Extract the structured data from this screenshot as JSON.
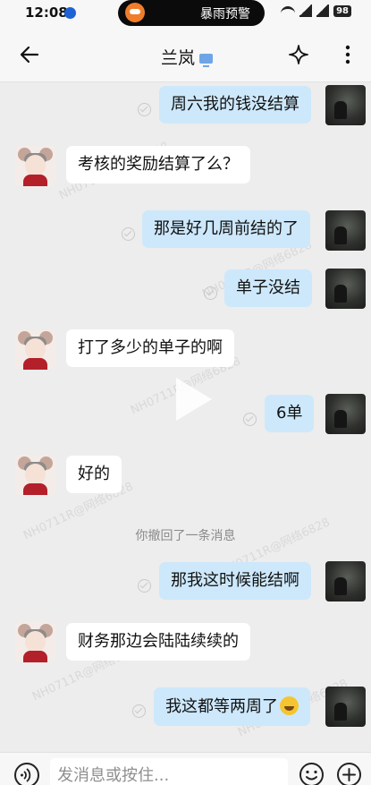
{
  "status_bar": {
    "time": "12:08",
    "alert": "暴雨预警",
    "battery": "98"
  },
  "header": {
    "title": "兰岚",
    "icons": [
      "back-arrow-icon",
      "device-icon",
      "sparkle-icon",
      "more-vertical-icon"
    ]
  },
  "messages": [
    {
      "from": "me",
      "text": "周六我的钱没结算"
    },
    {
      "from": "them",
      "text": "考核的奖励结算了么？"
    },
    {
      "from": "me",
      "text": "那是好几周前结的了"
    },
    {
      "from": "me",
      "text": "单子没结"
    },
    {
      "from": "them",
      "text": "打了多少的单子的啊"
    },
    {
      "from": "me",
      "text": "6单"
    },
    {
      "from": "them",
      "text": "好的"
    },
    {
      "from": "system",
      "text": "你撤回了一条消息"
    },
    {
      "from": "me",
      "text": "那我这时候能结啊"
    },
    {
      "from": "them",
      "text": "财务那边会陆陆续续的"
    },
    {
      "from": "me",
      "text": "我这都等两周了",
      "emoji": "laughing-tears-emoji"
    }
  ],
  "watermark": "NH0711R@网络6828",
  "input": {
    "placeholder": "发消息或按住..."
  },
  "colors": {
    "my_bubble": "#cde8fb",
    "their_bubble": "#ffffff",
    "background": "#ededed"
  }
}
